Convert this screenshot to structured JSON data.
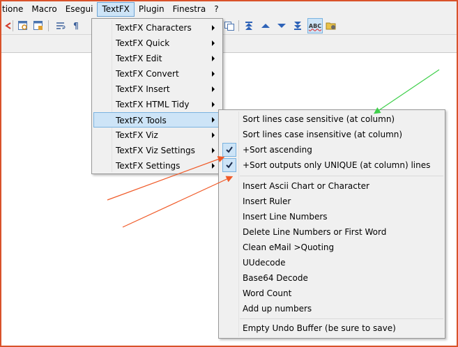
{
  "menubar": {
    "items": [
      "tione",
      "Macro",
      "Esegui",
      "TextFX",
      "Plugin",
      "Finestra",
      "?"
    ],
    "active": "TextFX"
  },
  "toolbar": {
    "icons": [
      "red-arrow-icon",
      "window-find-icon",
      "window-replace-icon",
      "wrap-icon",
      "pilcrow-icon",
      "window-tile-icon",
      "move-top-icon",
      "up-icon",
      "down-icon",
      "move-bottom-icon",
      "spellcheck-icon",
      "folder-icon"
    ],
    "pilcrow": "¶",
    "spell_label": "ABC"
  },
  "textfx_menu": {
    "items": [
      {
        "label": "TextFX Characters"
      },
      {
        "label": "TextFX Quick"
      },
      {
        "label": "TextFX Edit"
      },
      {
        "label": "TextFX Convert"
      },
      {
        "label": "TextFX Insert"
      },
      {
        "label": "TextFX HTML Tidy"
      },
      {
        "label": "TextFX Tools",
        "highlighted": true
      },
      {
        "label": "TextFX Viz"
      },
      {
        "label": "TextFX Viz Settings"
      },
      {
        "label": "TextFX Settings"
      }
    ]
  },
  "tools_menu": {
    "items": [
      {
        "label": "Sort lines case sensitive (at column)"
      },
      {
        "label": "Sort lines case insensitive (at column)"
      },
      {
        "label": "+Sort ascending",
        "checked": true
      },
      {
        "label": "+Sort outputs only UNIQUE (at column) lines",
        "checked": true
      },
      {
        "label": "Insert Ascii Chart or Character"
      },
      {
        "label": "Insert Ruler"
      },
      {
        "label": "Insert Line Numbers"
      },
      {
        "label": "Delete Line Numbers or First Word"
      },
      {
        "label": "Clean eMail >Quoting"
      },
      {
        "label": "UUdecode"
      },
      {
        "label": "Base64 Decode"
      },
      {
        "label": "Word Count"
      },
      {
        "label": "Add up numbers"
      },
      {
        "label": "Empty Undo Buffer (be sure to save)"
      }
    ]
  },
  "colors": {
    "frame_border": "#d9522a",
    "green_arrow": "#3ecf4a",
    "orange_arrow": "#f05a28",
    "highlight": "#cde4f7"
  }
}
